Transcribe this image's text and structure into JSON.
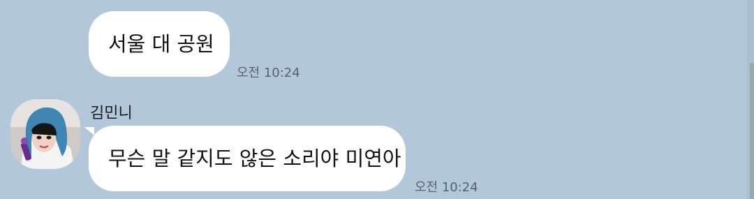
{
  "messages": [
    {
      "text": "서울 대 공원",
      "time": "오전 10:24"
    },
    {
      "sender": "김민니",
      "text": "무슨 말 같지도 않은 소리야 미연아",
      "time": "오전 10:24"
    }
  ],
  "colors": {
    "background": "#b2c7da",
    "bubble": "#ffffff",
    "time_text": "#556370"
  }
}
